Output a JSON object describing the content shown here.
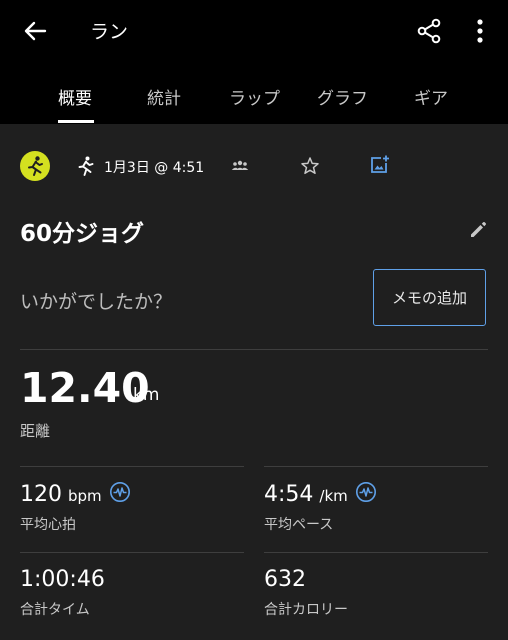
{
  "app_bar": {
    "title": "ラン"
  },
  "tabs": [
    {
      "label": "概要"
    },
    {
      "label": "統計"
    },
    {
      "label": "ラップ"
    },
    {
      "label": "グラフ"
    },
    {
      "label": "ギア"
    }
  ],
  "activity": {
    "datetime": "1月3日 @ 4:51",
    "name": "60分ジョグ",
    "prompt": "いかがでしたか？",
    "memo_button": "メモの追加"
  },
  "distance": {
    "value": "12.40",
    "unit": "km",
    "label": "距離"
  },
  "stats": [
    {
      "value": "120",
      "unit": "bpm",
      "label": "平均心拍"
    },
    {
      "value": "4:54",
      "unit": "/km",
      "label": "平均ペース"
    },
    {
      "value": "1:00:46",
      "unit": "",
      "label": "合計タイム"
    },
    {
      "value": "632",
      "unit": "",
      "label": "合計カロリー"
    }
  ],
  "colors": {
    "accent": "#5fa0e8",
    "activity_badge": "#d4e020",
    "background": "#1f1f1f",
    "header": "#000000"
  },
  "icons": [
    "back-arrow-icon",
    "share-icon",
    "more-vert-icon",
    "run-icon",
    "group-icon",
    "star-icon",
    "add-photo-icon",
    "pencil-icon",
    "pulse-icon"
  ]
}
